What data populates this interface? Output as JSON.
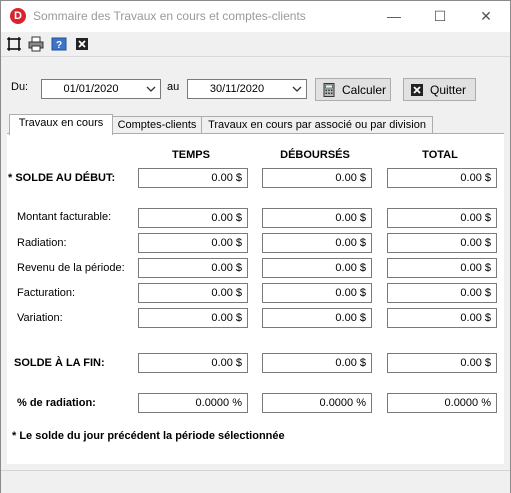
{
  "window": {
    "title": "Sommaire des Travaux en cours et comptes-clients",
    "app_icon_letter": "D",
    "minimize": "—",
    "maximize": "☐",
    "close": "✕"
  },
  "toolbar": {
    "icons": [
      "fit-icon",
      "print-icon",
      "help-icon",
      "close-icon"
    ]
  },
  "filters": {
    "from_label": "Du:",
    "from_value": "01/01/2020",
    "to_label": "au",
    "to_value": "30/11/2020"
  },
  "buttons": {
    "calculate": "Calculer",
    "quit": "Quitter"
  },
  "tabs": [
    {
      "label": "Travaux en cours",
      "active": true
    },
    {
      "label": "Comptes-clients",
      "active": false
    },
    {
      "label": "Travaux en cours par associé ou par division",
      "active": false
    }
  ],
  "columns": [
    "TEMPS",
    "DÉBOURSÉS",
    "TOTAL"
  ],
  "rows": [
    {
      "label": "* SOLDE AU DÉBUT:",
      "bold": true,
      "values": [
        "0.00 $",
        "0.00 $",
        "0.00 $"
      ]
    },
    {
      "label": "Montant facturable:",
      "bold": false,
      "values": [
        "0.00 $",
        "0.00 $",
        "0.00 $"
      ]
    },
    {
      "label": "Radiation:",
      "bold": false,
      "values": [
        "0.00 $",
        "0.00 $",
        "0.00 $"
      ]
    },
    {
      "label": "Revenu de la période:",
      "bold": false,
      "values": [
        "0.00 $",
        "0.00 $",
        "0.00 $"
      ]
    },
    {
      "label": "Facturation:",
      "bold": false,
      "values": [
        "0.00 $",
        "0.00 $",
        "0.00 $"
      ]
    },
    {
      "label": "Variation:",
      "bold": false,
      "values": [
        "0.00 $",
        "0.00 $",
        "0.00 $"
      ]
    },
    {
      "label": "SOLDE À LA FIN:",
      "bold": true,
      "values": [
        "0.00 $",
        "0.00 $",
        "0.00 $"
      ]
    },
    {
      "label": "% de radiation:",
      "bold": true,
      "values": [
        "0.0000 %",
        "0.0000 %",
        "0.0000 %"
      ]
    }
  ],
  "footnote": "* Le solde du jour précédent la période sélectionnée"
}
